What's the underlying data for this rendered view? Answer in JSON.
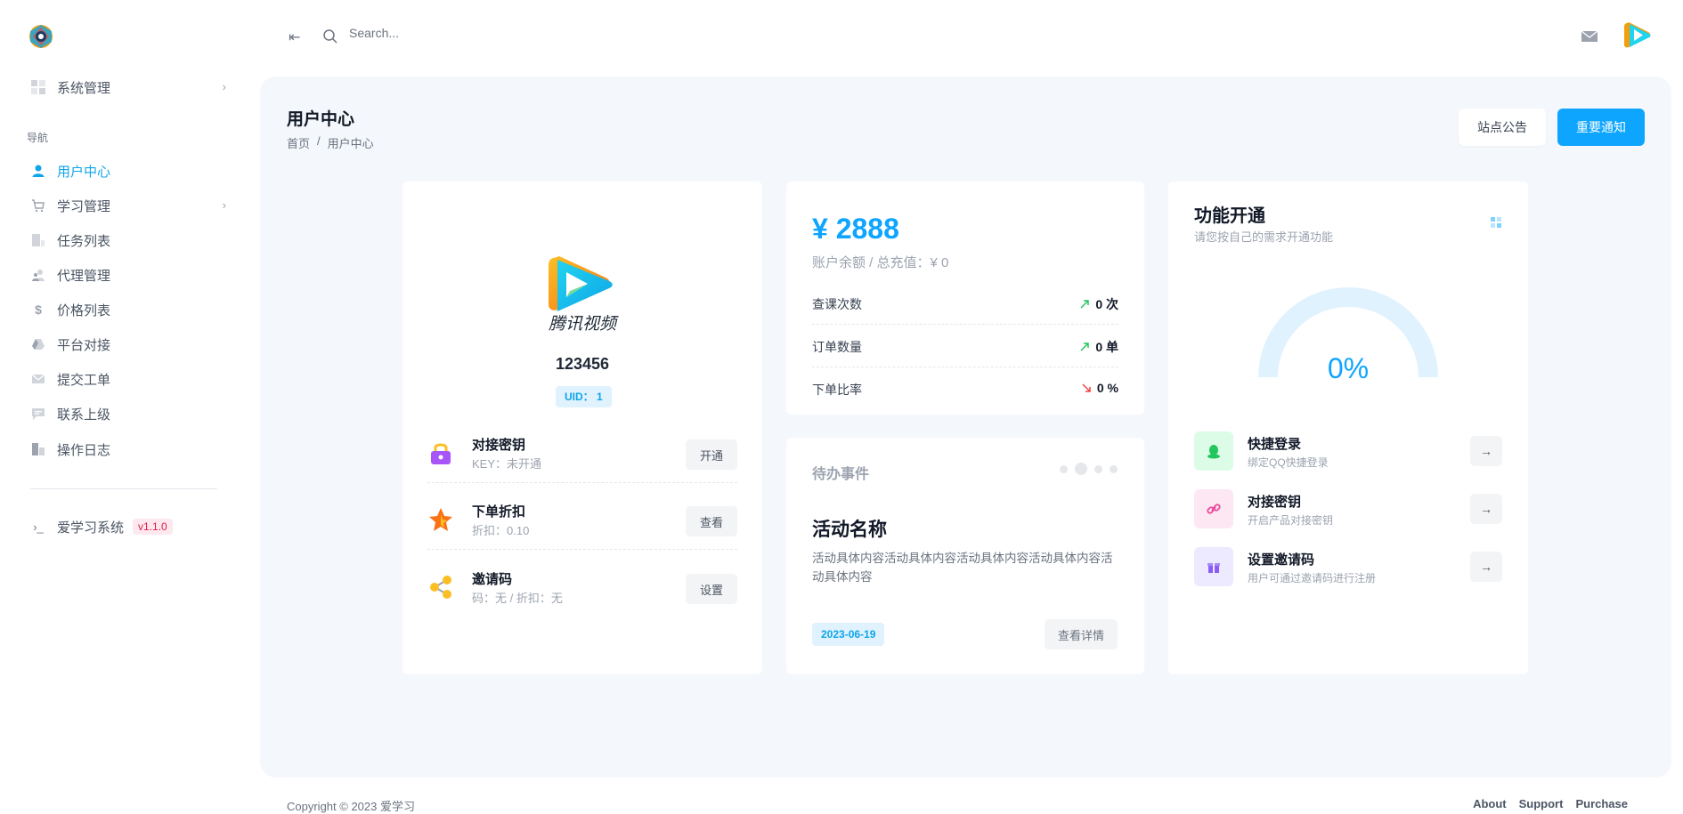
{
  "sidebar": {
    "items": [
      {
        "label": "系统管理"
      },
      {
        "label": "用户中心"
      },
      {
        "label": "学习管理"
      },
      {
        "label": "任务列表"
      },
      {
        "label": "代理管理"
      },
      {
        "label": "价格列表"
      },
      {
        "label": "平台对接"
      },
      {
        "label": "提交工单"
      },
      {
        "label": "联系上级"
      },
      {
        "label": "操作日志"
      }
    ],
    "section_label": "导航",
    "system_name": "爱学习系统",
    "version": "v1.1.0"
  },
  "header": {
    "search_placeholder": "Search..."
  },
  "page": {
    "title": "用户中心",
    "breadcrumb": [
      "首页",
      "/",
      "用户中心"
    ],
    "notice_button": "站点公告",
    "important_button": "重要通知"
  },
  "profile": {
    "username": "123456",
    "uid": "UID： 1",
    "avatar_text": "腾讯视频",
    "features": [
      {
        "title": "对接密钥",
        "sub": "KEY：未开通",
        "button": "开通"
      },
      {
        "title": "下单折扣",
        "sub": "折扣：0.10",
        "button": "查看"
      },
      {
        "title": "邀请码",
        "sub": "码：无 / 折扣：无",
        "button": "设置"
      }
    ]
  },
  "account": {
    "balance": "¥ 2888",
    "balance_sub": "账户余额 / 总充值：¥ 0",
    "stats": [
      {
        "label": "查课次数",
        "value": "0 次"
      },
      {
        "label": "订单数量",
        "value": "0 单"
      },
      {
        "label": "下单比率",
        "value": "0 %"
      }
    ]
  },
  "todo": {
    "title": "待办事件",
    "event_title": "活动名称",
    "event_body": "活动具体内容活动具体内容活动具体内容活动具体内容活动具体内容",
    "date": "2023-06-19",
    "detail_button": "查看详情"
  },
  "functions": {
    "title": "功能开通",
    "subtitle": "请您按自己的需求开通功能",
    "progress_percent": 0,
    "progress_label": "0%",
    "options": [
      {
        "title": "快捷登录",
        "sub": "绑定QQ快捷登录",
        "color": "#22c55e"
      },
      {
        "title": "对接密钥",
        "sub": "开启产品对接密钥",
        "color": "#ec4899"
      },
      {
        "title": "设置邀请码",
        "sub": "用户可通过邀请码进行注册",
        "color": "#8b5cf6"
      }
    ]
  },
  "footer": {
    "copyright": "Copyright © 2023 爱学习",
    "links": [
      "About",
      "Support",
      "Purchase"
    ]
  },
  "colors": {
    "accent": "#0ea5ff",
    "main_bg": "#f4f7fb"
  }
}
